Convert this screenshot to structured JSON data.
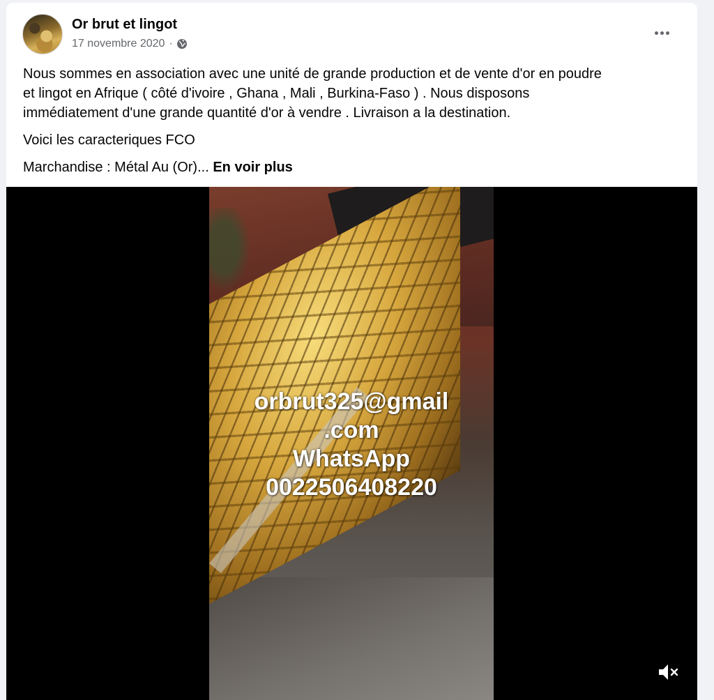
{
  "post": {
    "author": {
      "name": "Or brut et lingot",
      "avatar_icon": "gold-nuggets-avatar"
    },
    "date": "17 novembre 2020",
    "separator": "·",
    "audience_icon": "globe-icon",
    "more_icon": "more-options-icon",
    "text": {
      "paragraph_1": "Nous sommes en association avec une unité de grande production et de vente d'or en poudre\net lingot en Afrique ( côté d'ivoire , Ghana , Mali , Burkina-Faso ) . Nous disposons\nimmédiatement d'une grande quantité d'or à vendre . Livraison a la destination.",
      "paragraph_2": "Voici les caracteriques FCO",
      "paragraph_3": "Marchandise : Métal Au (Or)... ",
      "see_more": "En voir plus"
    },
    "video": {
      "overlay_lines": [
        "orbrut325@gmail",
        ".com",
        "WhatsApp",
        "0022506408220"
      ],
      "mute_icon": "speaker-muted-icon"
    }
  },
  "colors": {
    "background": "#f0f2f5",
    "card": "#ffffff",
    "secondary_text": "#65676b",
    "primary_text": "#050505",
    "video_bg": "#000000"
  }
}
